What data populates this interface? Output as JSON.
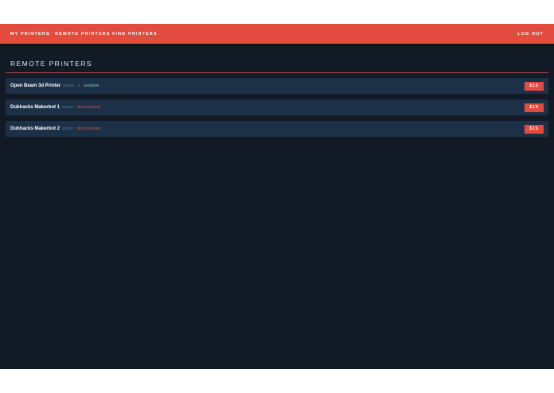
{
  "nav": {
    "links": [
      {
        "label": "MY PRINTERS"
      },
      {
        "label": "REMOTE PRINTERS"
      },
      {
        "label": "FIND PRINTERS"
      }
    ],
    "logout_label": "LOG OUT"
  },
  "page": {
    "title": "REMOTE PRINTERS"
  },
  "printers": [
    {
      "name": "Open Beam 3d Printer",
      "status_label": "status:",
      "status_icon": "✓",
      "status_value": "available",
      "price": "$15"
    },
    {
      "name": "Dubhacks Makerbot 1",
      "status_label": "status:",
      "status_value": "disconnected",
      "price": "$15"
    },
    {
      "name": "Dubhacks Makerbot 2",
      "status_label": "status:",
      "status_value": "disconnected",
      "price": "$15"
    }
  ],
  "colors": {
    "accent": "#e24b3d",
    "background": "#111a25",
    "row": "#1c3148",
    "status_available": "#6fc29c",
    "status_disconnected": "#c0554c"
  }
}
